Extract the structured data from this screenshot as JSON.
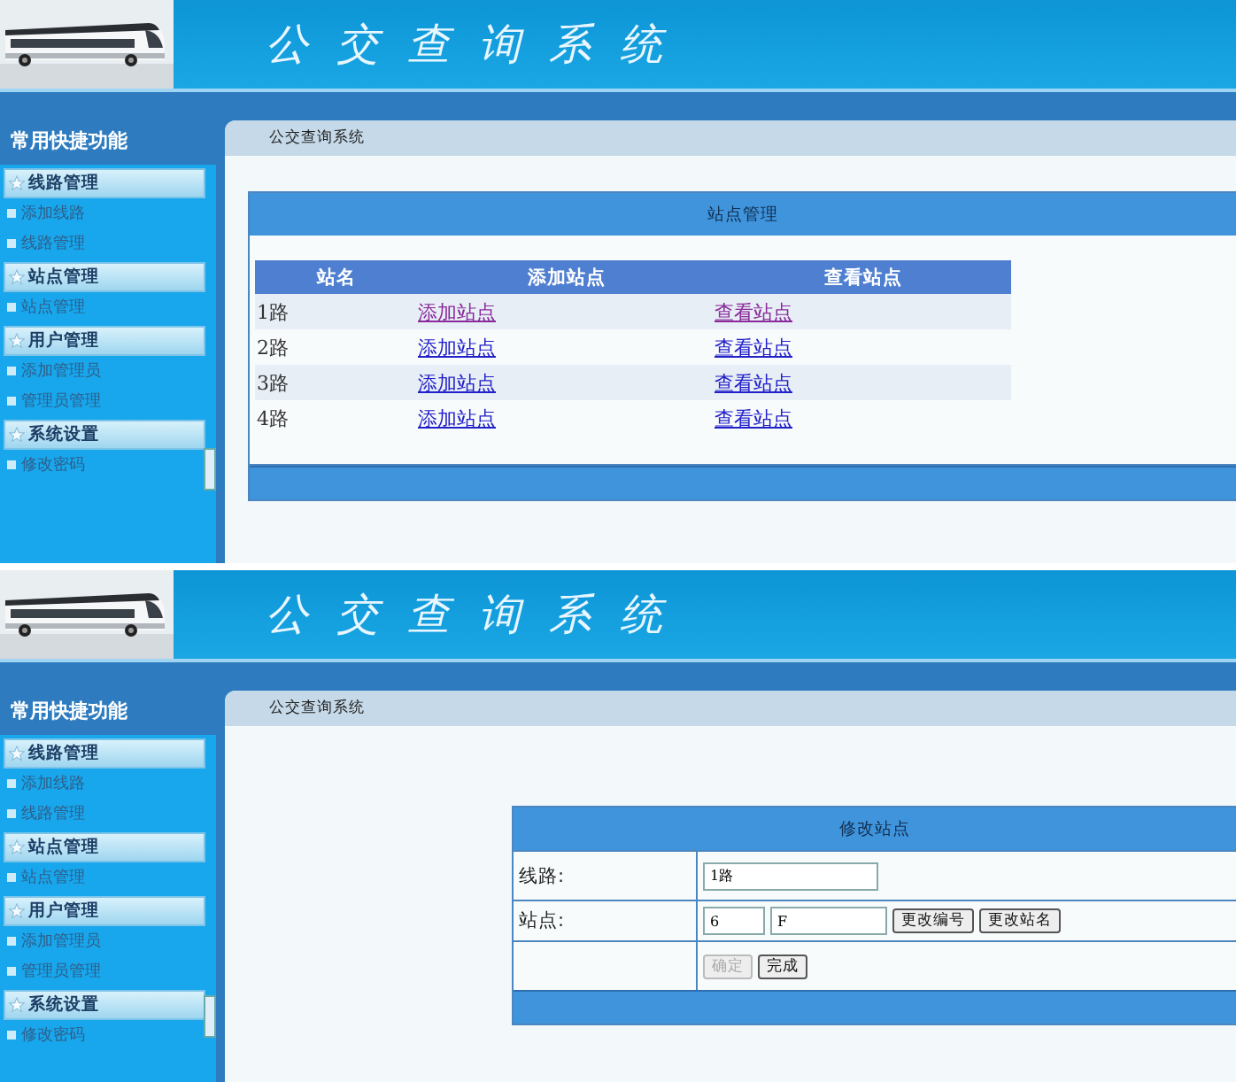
{
  "screens": [
    {
      "header": {
        "title": "公交查询系统"
      },
      "sidebar": {
        "title": "常用快捷功能",
        "groups": [
          {
            "label": "线路管理",
            "items": [
              {
                "label": "添加线路"
              },
              {
                "label": "线路管理"
              }
            ]
          },
          {
            "label": "站点管理",
            "items": [
              {
                "label": "站点管理"
              }
            ]
          },
          {
            "label": "用户管理",
            "items": [
              {
                "label": "添加管理员"
              },
              {
                "label": "管理员管理"
              }
            ]
          },
          {
            "label": "系统设置",
            "items": [
              {
                "label": "修改密码"
              }
            ]
          }
        ]
      },
      "breadcrumb": "公交查询系统",
      "panel": {
        "kind": "table",
        "title": "站点管理",
        "columns": [
          "站名",
          "添加站点",
          "查看站点"
        ],
        "rows": [
          {
            "name": "1路",
            "add": {
              "label": "添加站点",
              "visited": true
            },
            "view": {
              "label": "查看站点",
              "visited": true
            }
          },
          {
            "name": "2路",
            "add": {
              "label": "添加站点",
              "visited": false
            },
            "view": {
              "label": "查看站点",
              "visited": false
            }
          },
          {
            "name": "3路",
            "add": {
              "label": "添加站点",
              "visited": false
            },
            "view": {
              "label": "查看站点",
              "visited": false
            }
          },
          {
            "name": "4路",
            "add": {
              "label": "添加站点",
              "visited": false
            },
            "view": {
              "label": "查看站点",
              "visited": false
            }
          }
        ]
      }
    },
    {
      "header": {
        "title": "公交查询系统"
      },
      "sidebar": {
        "title": "常用快捷功能",
        "groups": [
          {
            "label": "线路管理",
            "items": [
              {
                "label": "添加线路"
              },
              {
                "label": "线路管理"
              }
            ]
          },
          {
            "label": "站点管理",
            "items": [
              {
                "label": "站点管理"
              }
            ]
          },
          {
            "label": "用户管理",
            "items": [
              {
                "label": "添加管理员"
              },
              {
                "label": "管理员管理"
              }
            ]
          },
          {
            "label": "系统设置",
            "items": [
              {
                "label": "修改密码"
              }
            ]
          }
        ]
      },
      "breadcrumb": "公交查询系统",
      "panel": {
        "kind": "form",
        "title": "修改站点",
        "fields": [
          {
            "label": "线路:",
            "inputs": [
              {
                "value": "1路"
              }
            ]
          },
          {
            "label": "站点:",
            "inputs": [
              {
                "value": "6"
              },
              {
                "value": "F"
              }
            ],
            "buttons": [
              {
                "label": "更改编号",
                "disabled": false
              },
              {
                "label": "更改站名",
                "disabled": false
              }
            ]
          },
          {
            "buttons": [
              {
                "label": "确定",
                "disabled": true
              },
              {
                "label": "完成",
                "disabled": false
              }
            ]
          }
        ]
      }
    }
  ]
}
